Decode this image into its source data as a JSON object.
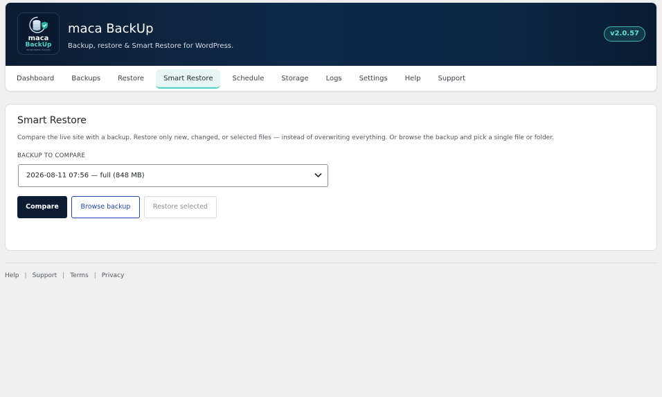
{
  "app": {
    "logo": {
      "word1": "maca",
      "word2": "BackUp",
      "tagline": "WORDPRESS PLUGIN"
    },
    "title": "maca BackUp",
    "subtitle": "Backup, restore & Smart Restore for WordPress.",
    "version": "v2.0.57"
  },
  "nav": {
    "tabs": [
      {
        "label": "Dashboard"
      },
      {
        "label": "Backups"
      },
      {
        "label": "Restore"
      },
      {
        "label": "Smart Restore",
        "active": true
      },
      {
        "label": "Schedule"
      },
      {
        "label": "Storage"
      },
      {
        "label": "Logs"
      },
      {
        "label": "Settings"
      },
      {
        "label": "Help"
      },
      {
        "label": "Support"
      }
    ]
  },
  "smart_restore": {
    "title": "Smart Restore",
    "description": "Compare the live site with a backup. Restore only new, changed, or selected files — instead of overwriting everything. Or browse the backup and pick a single file or folder.",
    "backup_label": "BACKUP TO COMPARE",
    "backup_selected": "2026-08-11 07:56 — full (848 MB)",
    "compare_label": "Compare",
    "browse_label": "Browse backup",
    "restore_selected_label": "Restore selected"
  },
  "footer": {
    "links": [
      "Help",
      "Support",
      "Terms",
      "Privacy"
    ],
    "separator": "|"
  },
  "colors": {
    "header_dark": "#0c1d33",
    "accent_teal": "#4fd1c5",
    "link_blue": "#2248a8",
    "page_bg": "#f0f0f1"
  },
  "icons": {
    "logo": "database-shield-icon",
    "select_arrow": "chevron-down-icon"
  }
}
